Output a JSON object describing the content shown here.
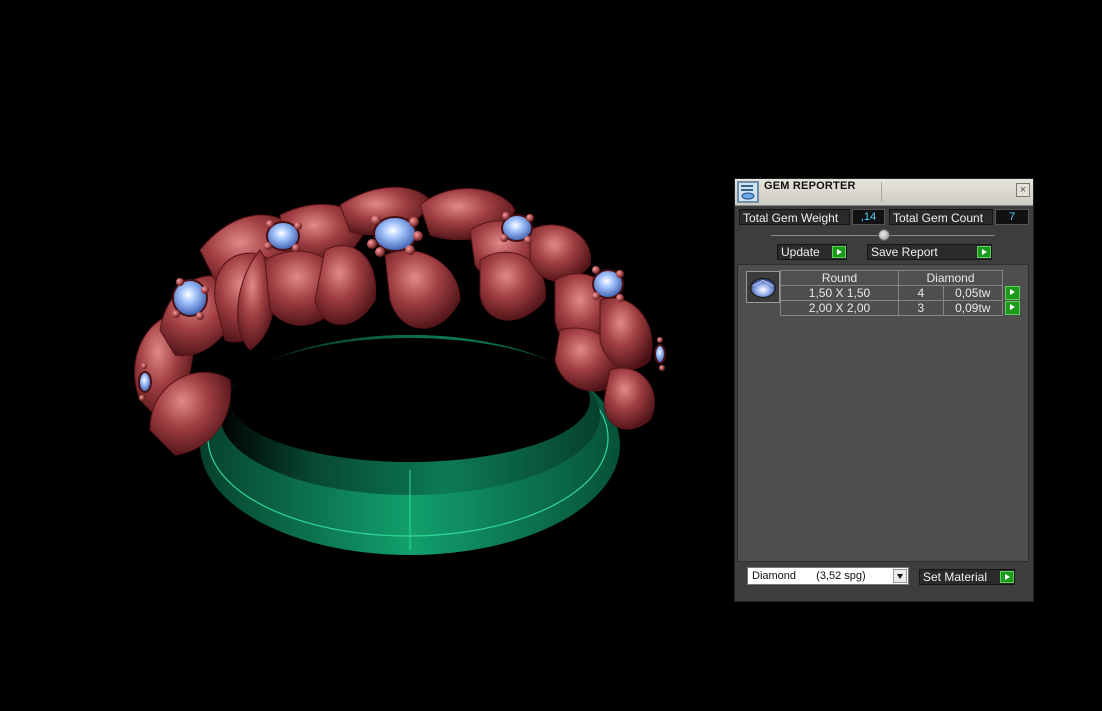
{
  "panel": {
    "title": "GEM REPORTER",
    "close_glyph": "×",
    "total_weight_label": "Total Gem Weight",
    "total_weight_value": ",14",
    "total_count_label": "Total Gem Count",
    "total_count_value": "7",
    "update_label": "Update",
    "save_report_label": "Save Report",
    "table": {
      "shape": "Round",
      "material": "Diamond",
      "rows": [
        {
          "size": "1,50 X 1,50",
          "count": "4",
          "weight": "0,05tw"
        },
        {
          "size": "2,00 X 2,00",
          "count": "3",
          "weight": "0,09tw"
        }
      ]
    },
    "material_select": {
      "name": "Diamond",
      "density": "(3,52 spg)"
    },
    "set_material_label": "Set Material"
  },
  "colors": {
    "flower_metal": "#a23f43",
    "shank_metal": "#0e7a55",
    "gem_blue": "#8fb8ff",
    "go_green": "#1b9a1b"
  },
  "icons": [
    "gem-reporter-icon",
    "close-icon",
    "play-arrow-icon",
    "round-gem-icon",
    "dropdown-arrow-icon"
  ]
}
